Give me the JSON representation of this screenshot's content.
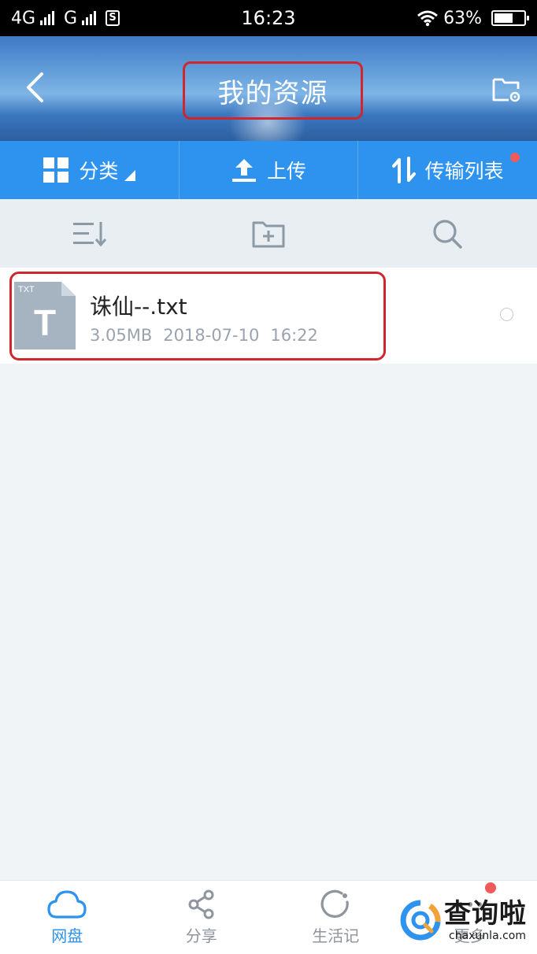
{
  "status_bar": {
    "network_1": "4G",
    "network_2": "G",
    "sim_badge": "S",
    "time": "16:23",
    "battery_text": "63%",
    "battery_level": 0.63
  },
  "header": {
    "title": "我的资源"
  },
  "action_bar": {
    "category_label": "分类",
    "upload_label": "上传",
    "transfer_label": "传输列表"
  },
  "files": [
    {
      "name": "诛仙--.txt",
      "size": "3.05MB",
      "date": "2018-07-10",
      "time": "16:22",
      "type_badge": "TXT",
      "type_letter": "T"
    }
  ],
  "bottom_nav": {
    "items": [
      {
        "label": "网盘",
        "icon": "cloud-icon",
        "active": true
      },
      {
        "label": "分享",
        "icon": "share-icon",
        "active": false
      },
      {
        "label": "生活记",
        "icon": "life-record-icon",
        "active": false
      },
      {
        "label": "更多",
        "icon": "more-icon",
        "active": false
      }
    ]
  },
  "watermark": {
    "cn": "查询啦",
    "en": "chaxunla.com"
  },
  "colors": {
    "accent": "#2e93ef",
    "highlight_red": "#d0262e",
    "badge_red": "#f05a5a"
  }
}
